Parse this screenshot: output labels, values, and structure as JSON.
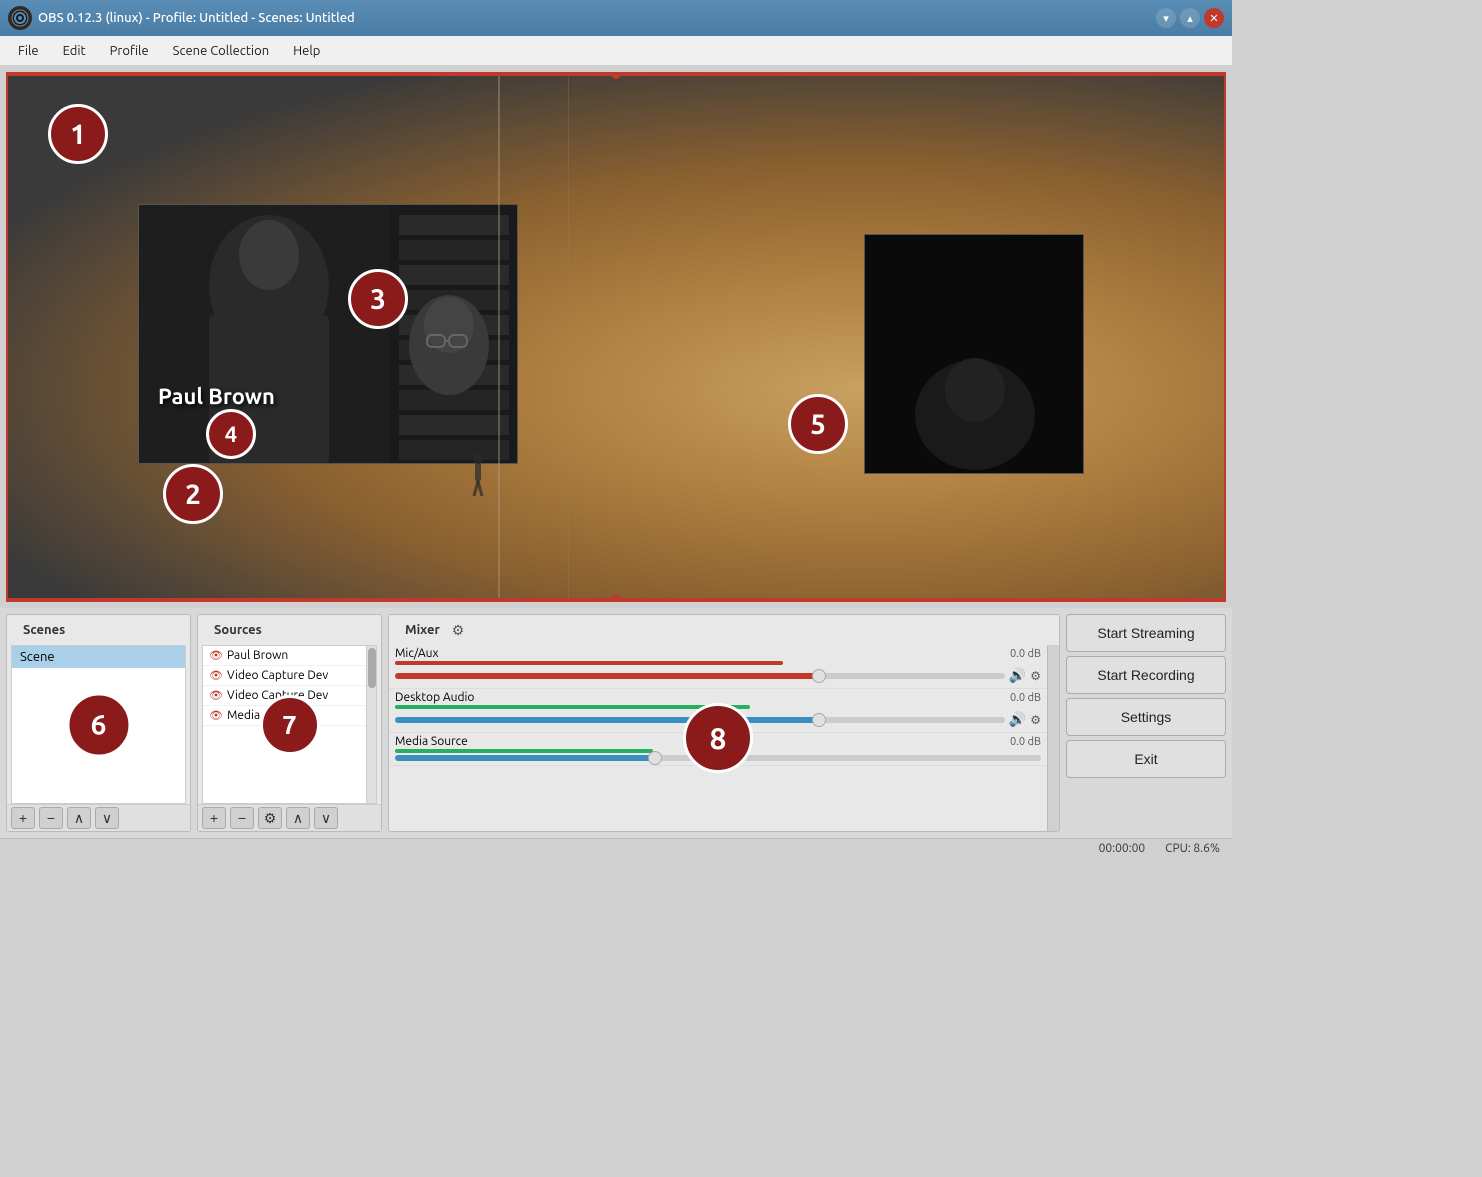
{
  "titlebar": {
    "title": "OBS 0.12.3 (linux) - Profile: Untitled - Scenes: Untitled",
    "logo_text": "●",
    "minimize_label": "▾",
    "maximize_label": "▴",
    "close_label": "✕"
  },
  "menubar": {
    "items": [
      {
        "label": "File",
        "id": "file"
      },
      {
        "label": "Edit",
        "id": "edit"
      },
      {
        "label": "Profile",
        "id": "profile"
      },
      {
        "label": "Scene Collection",
        "id": "scene-collection"
      },
      {
        "label": "Help",
        "id": "help"
      }
    ]
  },
  "preview": {
    "badge_labels": [
      "1",
      "2",
      "3",
      "4",
      "5"
    ],
    "name_overlay": "Paul Brown"
  },
  "scenes_panel": {
    "title": "Scenes",
    "items": [
      {
        "label": "Scene",
        "selected": true
      }
    ],
    "badge_label": "6",
    "toolbar": {
      "add": "+",
      "remove": "−",
      "up": "∧",
      "down": "∨"
    }
  },
  "sources_panel": {
    "title": "Sources",
    "items": [
      {
        "label": "Paul Brown",
        "visible": true
      },
      {
        "label": "Video Capture Dev",
        "visible": true
      },
      {
        "label": "Video Capture Dev",
        "visible": true
      },
      {
        "label": "Media Source",
        "visible": true
      }
    ],
    "badge_label": "7",
    "toolbar": {
      "add": "+",
      "remove": "−",
      "settings": "⚙",
      "up": "∧",
      "down": "∨"
    }
  },
  "mixer_panel": {
    "title": "Mixer",
    "channels": [
      {
        "name": "Mic/Aux",
        "db": "0.0 dB",
        "slider_pct": 70,
        "level_type": "red"
      },
      {
        "name": "Desktop Audio",
        "db": "0.0 dB",
        "slider_pct": 70,
        "level_type": "green"
      },
      {
        "name": "Media Source",
        "db": "0.0 dB",
        "slider_pct": 40,
        "level_type": "green"
      }
    ],
    "badge_label": "8"
  },
  "controls": {
    "start_streaming": "Start Streaming",
    "start_recording": "Start Recording",
    "settings": "Settings",
    "exit": "Exit"
  },
  "statusbar": {
    "time": "00:00:00",
    "cpu": "CPU: 8.6%"
  }
}
